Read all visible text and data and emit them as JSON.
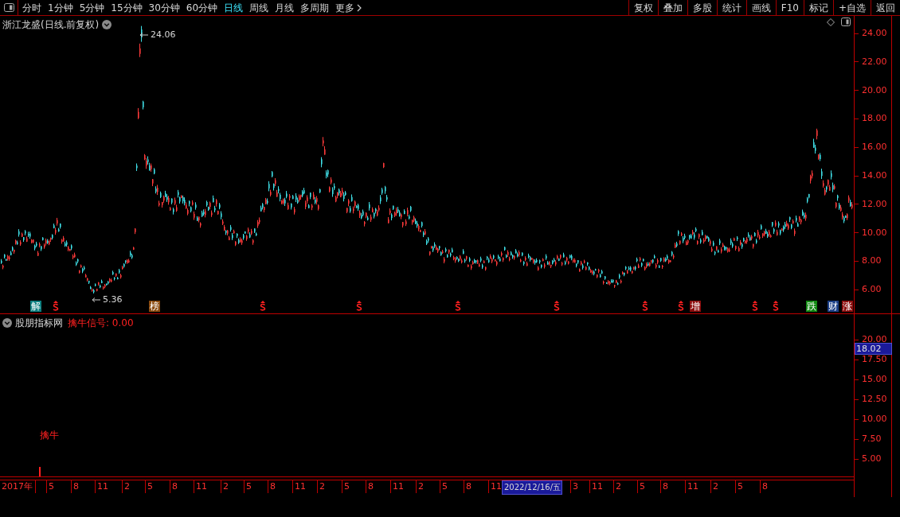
{
  "toolbar": {
    "periods": [
      {
        "label": "分时",
        "selected": false
      },
      {
        "label": "1分钟",
        "selected": false
      },
      {
        "label": "5分钟",
        "selected": false
      },
      {
        "label": "15分钟",
        "selected": false
      },
      {
        "label": "30分钟",
        "selected": false
      },
      {
        "label": "60分钟",
        "selected": false
      },
      {
        "label": "日线",
        "selected": true
      },
      {
        "label": "周线",
        "selected": false
      },
      {
        "label": "月线",
        "selected": false
      },
      {
        "label": "多周期",
        "selected": false
      },
      {
        "label": "更多",
        "selected": false
      }
    ],
    "actions": [
      "复权",
      "叠加",
      "多股",
      "统计",
      "画线",
      "F10",
      "标记",
      "+自选",
      "返回"
    ]
  },
  "chart": {
    "title": "浙江龙盛(日线.前复权)",
    "high_label": "24.06",
    "low_label": "5.36",
    "markers": [
      {
        "kind": "tag",
        "text": "解",
        "color": "#0d7f80"
      },
      {
        "kind": "signal"
      },
      {
        "kind": "tag",
        "text": "榜",
        "color": "#8a4a0e"
      },
      {
        "kind": "signal"
      },
      {
        "kind": "signal"
      },
      {
        "kind": "signal"
      },
      {
        "kind": "signal"
      },
      {
        "kind": "signal"
      },
      {
        "kind": "signal"
      },
      {
        "kind": "tag",
        "text": "增",
        "color": "#8b0d0d"
      },
      {
        "kind": "signal"
      },
      {
        "kind": "signal"
      },
      {
        "kind": "tag",
        "text": "跌",
        "color": "#128a12"
      },
      {
        "kind": "tag",
        "text": "财",
        "color": "#1b3f86"
      },
      {
        "kind": "tag",
        "text": "涨",
        "color": "#8b0d0d"
      }
    ],
    "price_axis": [
      "24.00",
      "22.00",
      "20.00",
      "18.00",
      "16.00",
      "14.00",
      "12.00",
      "10.00",
      "8.00",
      "6.00"
    ]
  },
  "indicator": {
    "name": "股朋指标网",
    "signal_label": "擒牛信号: 0.00",
    "signal_text": "擒牛",
    "axis": [
      "20.00",
      "17.50",
      "15.00",
      "12.50",
      "10.00",
      "7.50",
      "5.00"
    ],
    "current_value": "18.02"
  },
  "time_axis": [
    {
      "kind": "year",
      "label": "2017年"
    },
    {
      "kind": "month",
      "label": "5"
    },
    {
      "kind": "month",
      "label": "8"
    },
    {
      "kind": "month",
      "label": "11"
    },
    {
      "kind": "month",
      "label": "2"
    },
    {
      "kind": "month",
      "label": "5"
    },
    {
      "kind": "month",
      "label": "8"
    },
    {
      "kind": "month",
      "label": "11"
    },
    {
      "kind": "month",
      "label": "2"
    },
    {
      "kind": "month",
      "label": "5"
    },
    {
      "kind": "month",
      "label": "8"
    },
    {
      "kind": "month",
      "label": "11"
    },
    {
      "kind": "month",
      "label": "2"
    },
    {
      "kind": "month",
      "label": "5"
    },
    {
      "kind": "month",
      "label": "8"
    },
    {
      "kind": "month",
      "label": "11"
    },
    {
      "kind": "month",
      "label": "2"
    },
    {
      "kind": "month",
      "label": "5"
    },
    {
      "kind": "month",
      "label": "8"
    },
    {
      "kind": "month",
      "label": "11"
    },
    {
      "kind": "cursor",
      "label": "2022/12/16/五"
    },
    {
      "kind": "month",
      "label": "3"
    },
    {
      "kind": "month",
      "label": "11"
    },
    {
      "kind": "month",
      "label": "2"
    },
    {
      "kind": "month",
      "label": "5"
    },
    {
      "kind": "month",
      "label": "8"
    },
    {
      "kind": "month",
      "label": "11"
    },
    {
      "kind": "month",
      "label": "2"
    },
    {
      "kind": "month",
      "label": "5"
    },
    {
      "kind": "month",
      "label": "8"
    }
  ]
}
